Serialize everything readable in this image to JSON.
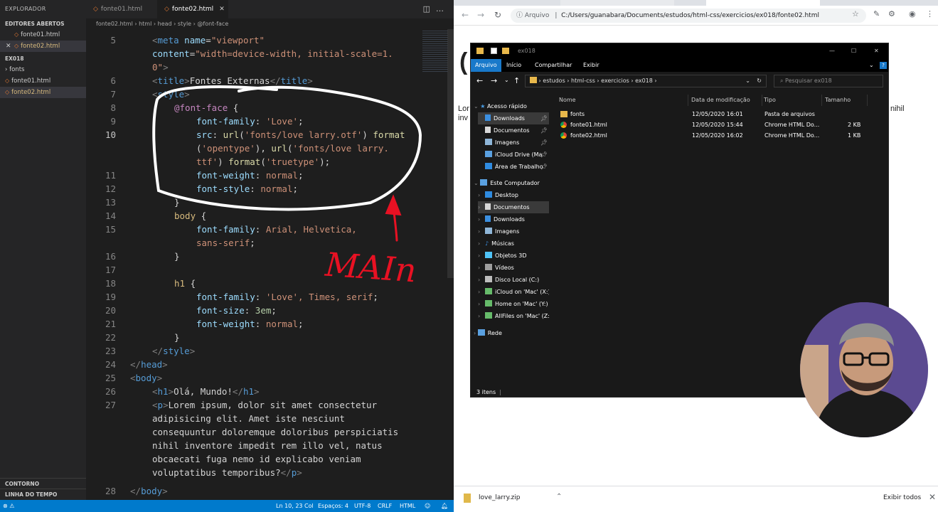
{
  "vscode": {
    "explorer": {
      "title": "EXPLORADOR",
      "open_editors_title": "EDITORES ABERTOS",
      "open_editors": [
        "fonte01.html",
        "fonte02.html"
      ],
      "workspace_title": "EX018",
      "folder": "fonts",
      "files": [
        "fonte01.html",
        "fonte02.html"
      ],
      "outline": "CONTORNO",
      "timeline": "LINHA DO TEMPO"
    },
    "tabs": [
      "fonte01.html",
      "fonte02.html"
    ],
    "breadcrumb": [
      "fonte02.html",
      "html",
      "head",
      "style",
      "@font-face"
    ],
    "line_numbers": [
      "5",
      "",
      "6",
      "7",
      "8",
      "9",
      "10",
      "",
      "",
      "11",
      "12",
      "13",
      "14",
      "15",
      "",
      "16",
      "17",
      "18",
      "19",
      "20",
      "21",
      "22",
      "23",
      "24",
      "25",
      "26",
      "27",
      "",
      "",
      "",
      "",
      "",
      "28"
    ],
    "code_text": {
      "l5a_tag": "meta",
      "l5a_attr": "name",
      "l5a_val": "\"viewport\"",
      "l5b_attr": "content",
      "l5b_val": "\"width=device-width, initial-scale=1.",
      "l5c_val": "0\"",
      "l6_text": "Fontes Externas",
      "l7_tag": "style",
      "l8": "@font-face",
      "l9_prop": "font-family",
      "l9_val": "'Love'",
      "l10_prop": "src",
      "l10_fn": "url",
      "l10_val": "'fonts/love larry.otf'",
      "l10_fn2": "format",
      "l10b_val": "'opentype'",
      "l10b_fn": "url",
      "l10b_val2": "'fonts/love larry.",
      "l10c_val": "ttf'",
      "l10c_fn": "format",
      "l10c_val2": "'truetype'",
      "l11_prop": "font-weight",
      "l11_val": "normal",
      "l12_prop": "font-style",
      "l12_val": "normal",
      "l14_sel": "body",
      "l15_prop": "font-family",
      "l15_val": "Arial, Helvetica,",
      "l15b_val": "sans-serif",
      "l18_sel": "h1",
      "l19_prop": "font-family",
      "l19_val": "'Love', Times, serif",
      "l20_prop": "font-size",
      "l20_val": "3em",
      "l21_prop": "font-weight",
      "l21_val": "normal",
      "l23_tag": "style",
      "l24_tag": "head",
      "l25_tag": "body",
      "l26_tag": "h1",
      "l26_text": "Olá, Mundo!",
      "l27_tag": "p",
      "l27_text": "Lorem ipsum, dolor sit amet consectetur",
      "l27b": "adipisicing elit. Amet iste nesciunt",
      "l27c": "consequuntur doloremque doloribus perspiciatis",
      "l27d": "nihil inventore impedit rem illo vel, natus",
      "l27e": "obcaecati fuga nemo id explicabo veniam",
      "l27f": "voluptatibus temporibus?",
      "l28_tag": "body"
    },
    "annotation_text": "MAIn",
    "status": {
      "position": "Ln 10, 23 Col",
      "spaces": "Espaços: 4",
      "encoding": "UTF-8",
      "eol": "CRLF",
      "language": "HTML"
    }
  },
  "browser": {
    "address_label": "Arquivo",
    "url": "C:/Users/guanabara/Documents/estudos/html-css/exercicios/ex018/fonte02.html",
    "page_text_left": [
      "Lor",
      "inv"
    ],
    "page_text_right": "nihil",
    "download": "love_larry.zip",
    "show_all": "Exibir todos"
  },
  "file_explorer": {
    "title": "ex018",
    "ribbon": [
      "Arquivo",
      "Início",
      "Compartilhar",
      "Exibir"
    ],
    "path": [
      "estudos",
      "html-css",
      "exercicios",
      "ex018"
    ],
    "search_placeholder": "Pesquisar ex018",
    "columns": [
      "Nome",
      "Data de modificação",
      "Tipo",
      "Tamanho"
    ],
    "rows": [
      {
        "name": "fonts",
        "date": "12/05/2020 16:01",
        "type": "Pasta de arquivos",
        "size": ""
      },
      {
        "name": "fonte01.html",
        "date": "12/05/2020 15:44",
        "type": "Chrome HTML Do...",
        "size": "2 KB"
      },
      {
        "name": "fonte02.html",
        "date": "12/05/2020 16:02",
        "type": "Chrome HTML Do...",
        "size": "1 KB"
      }
    ],
    "quick_access_title": "Acesso rápido",
    "quick_access": [
      "Downloads",
      "Documentos",
      "Imagens",
      "iCloud Drive (Ma",
      "Área de Trabalho"
    ],
    "this_pc_title": "Este Computador",
    "this_pc": [
      "Desktop",
      "Documentos",
      "Downloads",
      "Imagens",
      "Músicas",
      "Objetos 3D",
      "Vídeos",
      "Disco Local (C:)",
      "iCloud on 'Mac' (X:)",
      "Home on 'Mac' (Y:)",
      "AllFiles on 'Mac' (Z:)"
    ],
    "network": "Rede",
    "status": "3 itens"
  },
  "colors": {
    "vscode_bg": "#1e1e1e",
    "statusbar": "#007acc",
    "annotation_white": "#ffffff",
    "annotation_red": "#e81123",
    "explorer_active_tab": "#1979ca"
  }
}
